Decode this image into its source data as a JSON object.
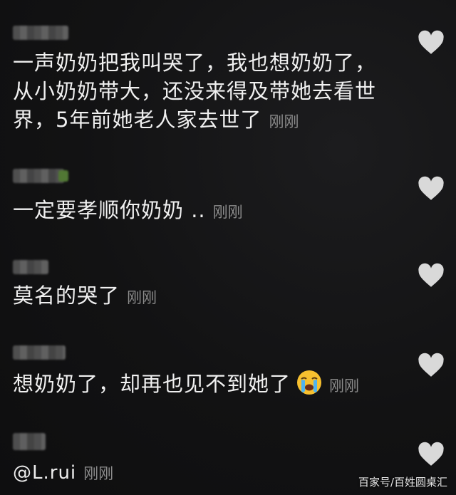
{
  "comments": [
    {
      "text": "一声奶奶把我叫哭了，我也想奶奶了，从小奶奶带大，还没来得及带她去看世界，5年前她老人家去世了",
      "line1": "一声奶奶把我叫哭了，我也想奶奶了，",
      "line2": "从小奶奶带大，还没来得及带她去看世",
      "line3": "界，5年前她老人家去世了",
      "time": "刚刚"
    },
    {
      "text": "一定要孝顺你奶奶 ..",
      "time": "刚刚"
    },
    {
      "text": "莫名的哭了",
      "time": "刚刚"
    },
    {
      "text": "想奶奶了，却再也见不到她了",
      "emoji": "loudly-crying-face-emoji",
      "time": "刚刚"
    },
    {
      "text": "@L.rui",
      "time": "刚刚"
    }
  ],
  "watermark": "百家号/百姓圆桌汇",
  "icons": {
    "like": "heart-icon"
  },
  "colors": {
    "background": "#121213",
    "text": "#f0f0f0",
    "timestamp": "#8c8c8c",
    "heart": "#d9d9d9"
  }
}
